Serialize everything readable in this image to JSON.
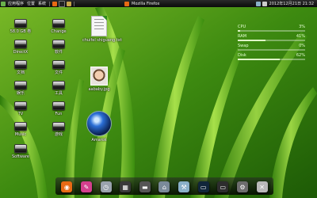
{
  "topbar": {
    "left_items": [
      "应用程序",
      "位置",
      "系统"
    ],
    "window_title": "Mozilla Firefox",
    "clock": "2012年12月21日 21:32"
  },
  "desktop_icons": [
    {
      "label": "58.0 GB 卷",
      "icon": "drive-icon"
    },
    {
      "label": "Change",
      "icon": "drive-icon"
    },
    {
      "label": "DirectX",
      "icon": "drive-icon"
    },
    {
      "label": "软件",
      "icon": "drive-icon"
    },
    {
      "label": "文档",
      "icon": "drive-icon"
    },
    {
      "label": "文件",
      "icon": "drive-icon"
    },
    {
      "label": "娱乐",
      "icon": "drive-icon"
    },
    {
      "label": "工具",
      "icon": "drive-icon"
    },
    {
      "label": "TV",
      "icon": "drive-icon"
    },
    {
      "label": "Fun",
      "icon": "drive-icon"
    },
    {
      "label": "Music",
      "icon": "drive-icon"
    },
    {
      "label": "游戏",
      "icon": "drive-icon"
    },
    {
      "label": "Software",
      "icon": "drive-icon"
    },
    {
      "label": "chuifel shiguang.txt",
      "icon": "text-document-icon"
    },
    {
      "label": "aababy.jpg",
      "icon": "photo-icon"
    },
    {
      "label": "Amarok",
      "icon": "app-icon"
    }
  ],
  "panel": {
    "rows": [
      {
        "label": "CPU",
        "value": "3%",
        "fill": 0.03
      },
      {
        "label": "RAM",
        "value": "41%",
        "fill": 0.41
      },
      {
        "label": "Swap",
        "value": "0%",
        "fill": 0
      },
      {
        "label": "Disk",
        "value": "62%",
        "fill": 0.62
      }
    ]
  },
  "dock": [
    {
      "name": "firefox-icon",
      "color": "#e76a14",
      "glyph": "◉"
    },
    {
      "name": "paint-icon",
      "color": "#d43f8d",
      "glyph": "✎"
    },
    {
      "name": "clock-icon",
      "color": "#9aa3ad",
      "glyph": "◷"
    },
    {
      "name": "media-icon",
      "color": "#3a3a3a",
      "glyph": "▦"
    },
    {
      "name": "disk-icon",
      "color": "#555555",
      "glyph": "▬"
    },
    {
      "name": "home-icon",
      "color": "#7a8a99",
      "glyph": "⌂"
    },
    {
      "name": "network-icon",
      "color": "#8ab0c8",
      "glyph": "⚒"
    },
    {
      "name": "terminal-icon",
      "color": "#11263a",
      "glyph": "▭"
    },
    {
      "name": "monitor-icon",
      "color": "#2d2d2d",
      "glyph": "▭"
    },
    {
      "name": "settings-icon",
      "color": "#6d6d6d",
      "glyph": "⚙"
    },
    {
      "name": "trash-icon",
      "color": "#b9b9b9",
      "glyph": "✕"
    }
  ]
}
